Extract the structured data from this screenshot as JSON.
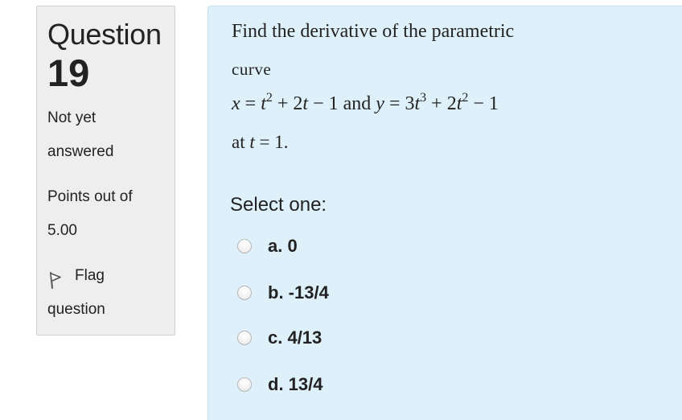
{
  "info": {
    "question_word": "Question",
    "question_number": "19",
    "status_line1": "Not yet",
    "status_line2": "answered",
    "points_line1": "Points out of",
    "points_line2": "5.00",
    "flag_line1": "Flag",
    "flag_line2": "question",
    "flag_icon": "flag-icon"
  },
  "question": {
    "line1": "Find the derivative of the parametric",
    "line2": "curve",
    "formula": {
      "x_var": "x",
      "x_eq": " = ",
      "x_t1": "t",
      "x_exp1": "2",
      "x_rest": " + 2",
      "x_t2": "t",
      "x_tail": " − 1 and ",
      "y_var": "y",
      "y_eq": " = 3",
      "y_t1": "t",
      "y_exp1": "3",
      "y_mid": " + 2",
      "y_t2": "t",
      "y_exp2": "2",
      "y_tail": " − 1"
    },
    "at_prefix": "at ",
    "at_var": "t",
    "at_suffix": " = 1."
  },
  "answer": {
    "prompt": "Select one:",
    "options": [
      {
        "label": "a. 0",
        "selected": false
      },
      {
        "label": "b. -13/4",
        "selected": false
      },
      {
        "label": "c. 4/13",
        "selected": false
      },
      {
        "label": "d. 13/4",
        "selected": false
      }
    ]
  },
  "colors": {
    "info_bg": "#eeeeee",
    "content_bg": "#def1fa",
    "text": "#222222"
  }
}
